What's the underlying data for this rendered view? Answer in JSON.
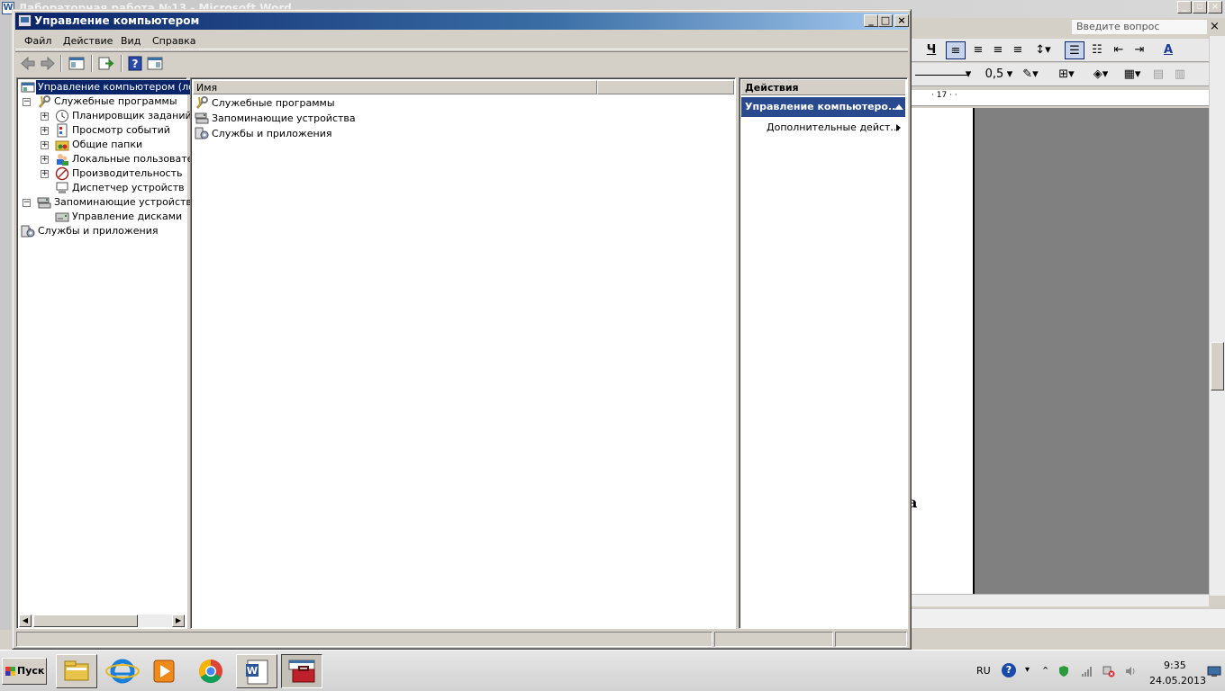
{
  "word": {
    "title": "Лабораторная работа №13 - Microsoft Word",
    "ask_placeholder": "Введите вопрос",
    "ask_close": "×",
    "line_spacing": "0,5",
    "ruler_mark": "· 17 · ·",
    "page_char": "a",
    "underline_label": "Ч",
    "font_color_label": "A"
  },
  "cm": {
    "title": "Управление компьютером",
    "caption_minimize": "_",
    "caption_maximize": "□",
    "caption_close": "×",
    "menu": [
      "Файл",
      "Действие",
      "Вид",
      "Справка"
    ],
    "tree": [
      {
        "label": "Управление компьютером (лока",
        "selected": true,
        "icon": "computer-management-icon"
      },
      {
        "label": "Служебные программы",
        "icon": "system-tools-icon",
        "exp": "−"
      },
      {
        "label": "Планировщик заданий",
        "icon": "task-scheduler-icon",
        "exp": "+"
      },
      {
        "label": "Просмотр событий",
        "icon": "event-viewer-icon",
        "exp": "+"
      },
      {
        "label": "Общие папки",
        "icon": "shared-folders-icon",
        "exp": "+"
      },
      {
        "label": "Локальные пользовател",
        "icon": "local-users-icon",
        "exp": "+"
      },
      {
        "label": "Производительность",
        "icon": "performance-icon",
        "exp": "+"
      },
      {
        "label": "Диспетчер устройств",
        "icon": "device-manager-icon",
        "exp": ""
      },
      {
        "label": "Запоминающие устройства",
        "icon": "storage-icon",
        "exp": "−"
      },
      {
        "label": "Управление дисками",
        "icon": "disk-management-icon",
        "exp": ""
      },
      {
        "label": "Службы и приложения",
        "icon": "services-apps-icon",
        "exp": "+"
      }
    ],
    "list": {
      "column_name": "Имя",
      "items": [
        "Служебные программы",
        "Запоминающие устройства",
        "Службы и приложения"
      ]
    },
    "actions": {
      "header": "Действия",
      "group": "Управление компьютеро...",
      "item": "Дополнительные дейст..."
    }
  },
  "taskbar": {
    "start": "Пуск",
    "lang": "RU",
    "help": "?",
    "time": "9:35",
    "date": "24.05.2013",
    "accent": "#0a246a"
  }
}
